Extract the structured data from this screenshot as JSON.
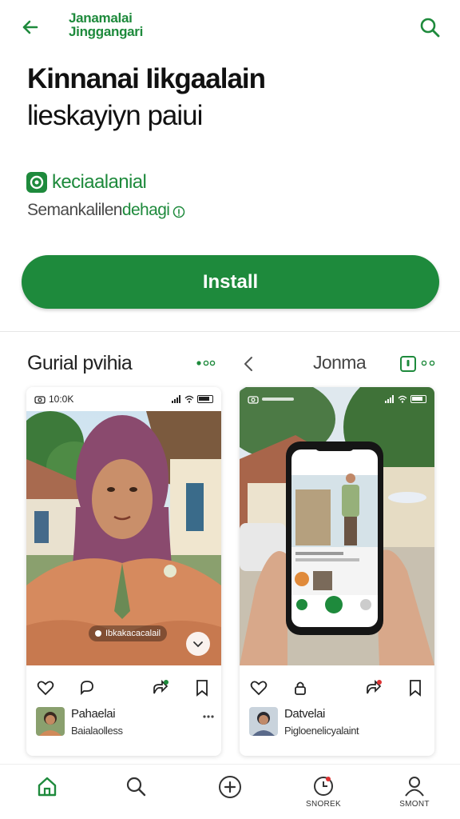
{
  "header": {
    "brand_line1": "Janamalai",
    "brand_line2": "Jinggangari"
  },
  "app": {
    "title_line1": "Kinnanai Iikgaalain",
    "title_line2": "lieskayiyn paiui",
    "developer": "keciaalanial",
    "meta_text": "Semankalilen",
    "meta_accent": "dehagi",
    "install_label": "Install"
  },
  "panels": {
    "left_title": "Gurial pvihia",
    "right_title": "Jonma"
  },
  "cards": [
    {
      "status_time": "10:0K",
      "caption": "Ibkakacacalail",
      "username": "Pahaelai",
      "subtitle": "Baialaolless"
    },
    {
      "status_time": "",
      "username": "Datvelai",
      "subtitle": "Pigloenelicyalaint"
    }
  ],
  "bottom_nav": [
    {
      "icon": "home-icon",
      "label": ""
    },
    {
      "icon": "search-icon",
      "label": ""
    },
    {
      "icon": "add-icon",
      "label": ""
    },
    {
      "icon": "timer-icon",
      "label": "SNOREK"
    },
    {
      "icon": "profile-icon",
      "label": "SMONT"
    }
  ],
  "colors": {
    "accent": "#1e8a3c",
    "text": "#1f1f1f"
  }
}
